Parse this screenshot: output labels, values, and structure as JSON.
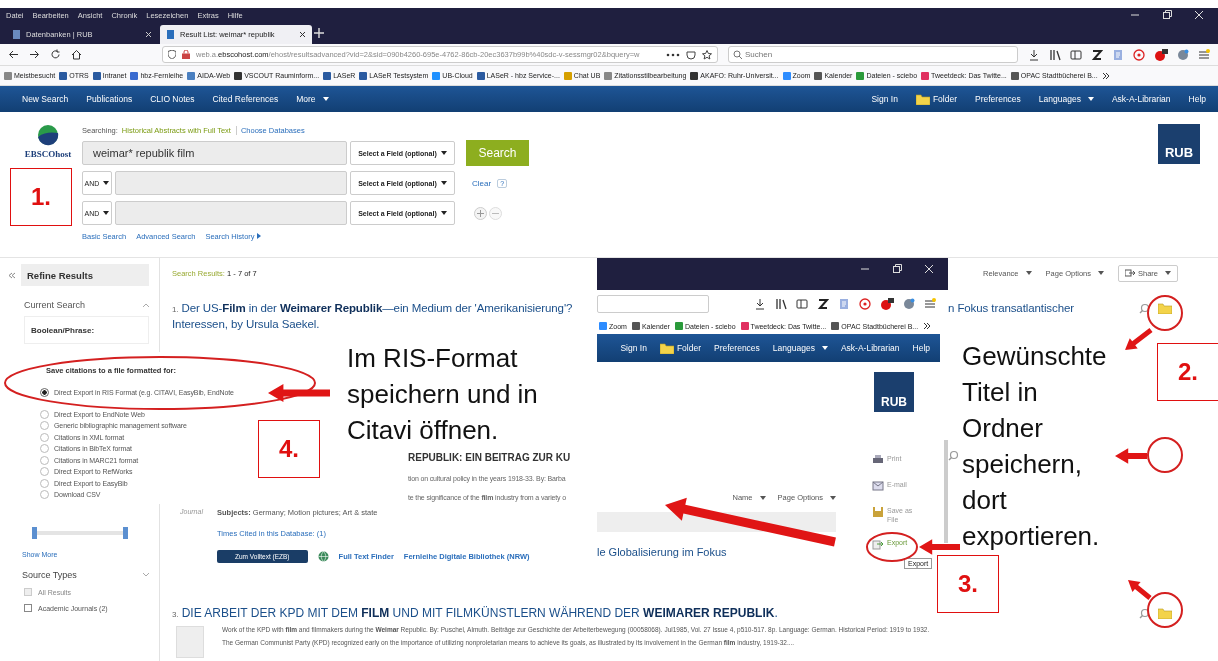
{
  "browser": {
    "menu": [
      "Datei",
      "Bearbeiten",
      "Ansicht",
      "Chronik",
      "Lesezeichen",
      "Extras",
      "Hilfe"
    ],
    "tabs": [
      {
        "label": "Datenbanken | RUB",
        "selected": false
      },
      {
        "label": "Result List: weimar* republik",
        "selected": true
      }
    ],
    "address": "web.a.**ebscohost.com**/ehost/resultsadvanced?vid=2&sid=090b4260-695e-4762-86cb-20ec3637b99b%40sdc-v-sessmgr02&bquery=w",
    "search_placeholder": "Suchen",
    "bookmarks": [
      "Meistbesucht",
      "OTRS",
      "Intranet",
      "hbz-Fernleihe",
      "AIDA-Web",
      "VSCOUT Rauminform...",
      "LASeR",
      "LASeR Testsystem",
      "UB-Cloud",
      "LASeR - hbz Service-...",
      "Chat UB",
      "Zitationsstilbearbeitung",
      "AKAFO: Ruhr-Universit...",
      "Zoom",
      "Kalender",
      "Dateien - sciebo",
      "Tweetdeck: Das Twitte...",
      "OPAC Stadtbücherei B..."
    ]
  },
  "nav": {
    "left": [
      {
        "label": "New Search",
        "kind": "link"
      },
      {
        "label": "Publications",
        "kind": "link"
      },
      {
        "label": "CLIO Notes",
        "kind": "link"
      },
      {
        "label": "Cited References",
        "kind": "link"
      },
      {
        "label": "More",
        "kind": "dropdown"
      }
    ],
    "right": [
      {
        "label": "Sign In",
        "kind": "link"
      },
      {
        "label": "Folder",
        "kind": "folder"
      },
      {
        "label": "Preferences",
        "kind": "link"
      },
      {
        "label": "Languages",
        "kind": "dropdown"
      },
      {
        "label": "Ask-A-Librarian",
        "kind": "link"
      },
      {
        "label": "Help",
        "kind": "link"
      }
    ]
  },
  "search": {
    "logo": "EBSCOhost",
    "searching_label": "Searching:",
    "database": "Historical Abstracts with Full Text",
    "choose_link": "Choose Databases",
    "rows": [
      {
        "value": "weimar* republik film",
        "field": "Select a Field (optional)"
      },
      {
        "operator": "AND",
        "field": "Select a Field (optional)"
      },
      {
        "operator": "AND",
        "field": "Select a Field (optional)"
      }
    ],
    "search_button": "Search",
    "clear": "Clear",
    "help": "?",
    "links": [
      "Basic Search",
      "Advanced Search",
      "Search History"
    ],
    "institution_logo": "RUB"
  },
  "sidebar": {
    "title": "Refine Results",
    "current_search": "Current Search",
    "boolean_label": "Boolean/Phrase:",
    "date_slider": {
      "level": 1
    },
    "show_more": "Show More",
    "source_types": "Source Types",
    "sources": [
      {
        "label": "All Results",
        "checked": false,
        "disabled": true
      },
      {
        "label": "Academic Journals (2)",
        "checked": false,
        "disabled": false
      }
    ]
  },
  "results": {
    "label": "Search Results:",
    "range": "1 - 7 of 7",
    "sort": "Relevance",
    "page_options": "Page Options",
    "share": "Share",
    "first": {
      "number": "1.",
      "title": "Der US-**Film** in der **Weimarer Republik**—ein Medium der 'Amerikanisierung'?",
      "title_tail": "n Fokus transatlantischer",
      "title_line_2": "Interessen, by Ursula Saekel."
    },
    "second": {
      "title": "REPUBLIK: EIN BEITRAG ZUR KU",
      "snippet_lines": [
        "tion on cultural policy in the years 1918-33. By: Barba",
        "te the significance of the **film** industry from a variety o"
      ],
      "type": "Journal",
      "subjects": "**Subjects:** Germany; Motion pictures; Art & state",
      "times_cited": "Times Cited in this Database: (1)",
      "fulltext_button": "Zum Volltext (EZB)",
      "links": [
        "Full Text Finder",
        "Fernleihe Digitale Bibliothek (NRW)"
      ]
    },
    "third": {
      "number": "3.",
      "title": "DIE ARBEIT DER KPD MIT DEM **FILM** UND MIT FILMKÜNSTLERN WÄHREND DER **WEIMARER REPUBLIK**.",
      "lines": [
        "Work of the KPD with **film** and filmmakers during the **Weimar** Republic. By: Puschel, Almuth. Beiträge zur Geschichte der Arbeiterbewegung (00058068). Jul1985, Vol. 27 Issue 4, p510-517. 8p. Language: German. Historical Period: 1919 to 1932.",
        "The German Communist Party (KPD) recognized early on the importance of utilizing nonproletarian means to achieve its goals, as illustrated by its involvement in the German **film** industry, 1919-32...."
      ]
    }
  },
  "export_dialog": {
    "title": "Save citations to a file formatted for:",
    "options": [
      {
        "label": "Direct Export in RIS Format (e.g. CITAVI, EasyBib, EndNote",
        "selected": true
      },
      {
        "label": "Direct Export to EndNote Web",
        "selected": false
      },
      {
        "label": "Generic bibliographic management software",
        "selected": false
      },
      {
        "label": "Citations in XML format",
        "selected": false
      },
      {
        "label": "Citations in BibTeX format",
        "selected": false
      },
      {
        "label": "Citations in MARC21 format",
        "selected": false
      },
      {
        "label": "Direct Export to RefWorks",
        "selected": false
      },
      {
        "label": "Direct Export to EasyBib",
        "selected": false
      },
      {
        "label": "Download CSV",
        "selected": false
      }
    ]
  },
  "inset": {
    "bookmarks": [
      "Zoom",
      "Kalender",
      "Dateien - sciebo",
      "Tweetdeck: Das Twitte...",
      "OPAC Stadtbücherei B..."
    ],
    "nav": [
      {
        "label": "Sign In",
        "kind": "link"
      },
      {
        "label": "Folder",
        "kind": "folder"
      },
      {
        "label": "Preferences",
        "kind": "link"
      },
      {
        "label": "Languages",
        "kind": "dropdown"
      },
      {
        "label": "Ask-A-Librarian",
        "kind": "link"
      },
      {
        "label": "Help",
        "kind": "link"
      }
    ],
    "logo": "RUB",
    "sort": "Name",
    "page_options": "Page Options",
    "result_fragment": "le Globalisierung im Fokus",
    "tools": [
      {
        "label": "Print",
        "kind": "print"
      },
      {
        "label": "E-mail",
        "kind": "email"
      },
      {
        "label": "Save as File",
        "kind": "save"
      },
      {
        "label": "Export",
        "kind": "export"
      }
    ],
    "tooltip": "Export"
  },
  "annotations": {
    "left_note": "Im RIS-Format speichern und in Citavi öffnen.",
    "right_note": "Gewünschte Titel in Ordner speichern, dort exportieren.",
    "steps": [
      "1.",
      "2.",
      "3.",
      "4."
    ]
  }
}
